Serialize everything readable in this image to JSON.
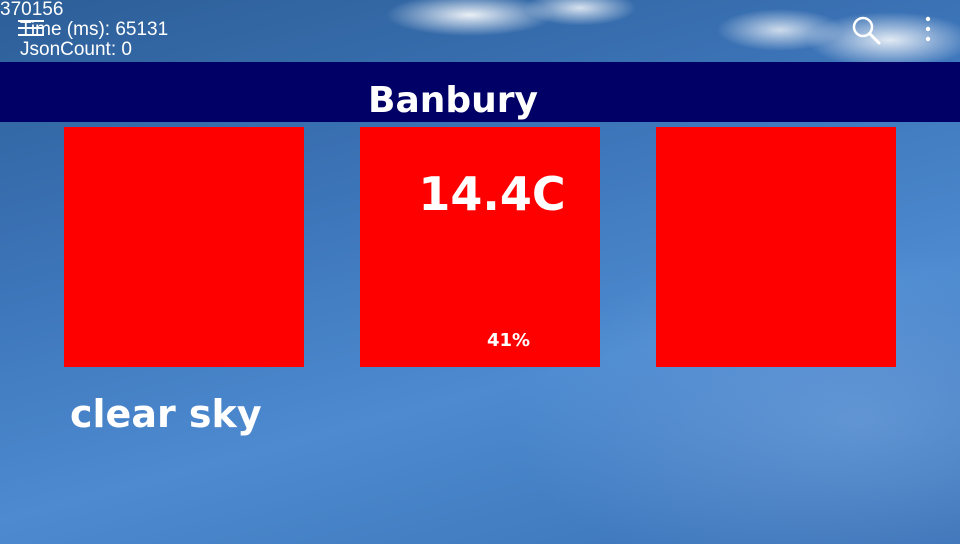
{
  "debug": {
    "code": "370156",
    "time": "Time (ms): 65131",
    "json_count": "JsonCount: 0"
  },
  "toolbar": {
    "menu_icon": "hamburger-menu-icon",
    "search_icon": "search-icon",
    "overflow_icon": "overflow-menu-icon"
  },
  "header": {
    "city": "Banbury"
  },
  "weather": {
    "temperature": "14.4C",
    "humidity": "41%",
    "description": "clear sky"
  },
  "colors": {
    "title_bar": "#000066",
    "tile": "#ff0000",
    "text": "#ffffff"
  }
}
